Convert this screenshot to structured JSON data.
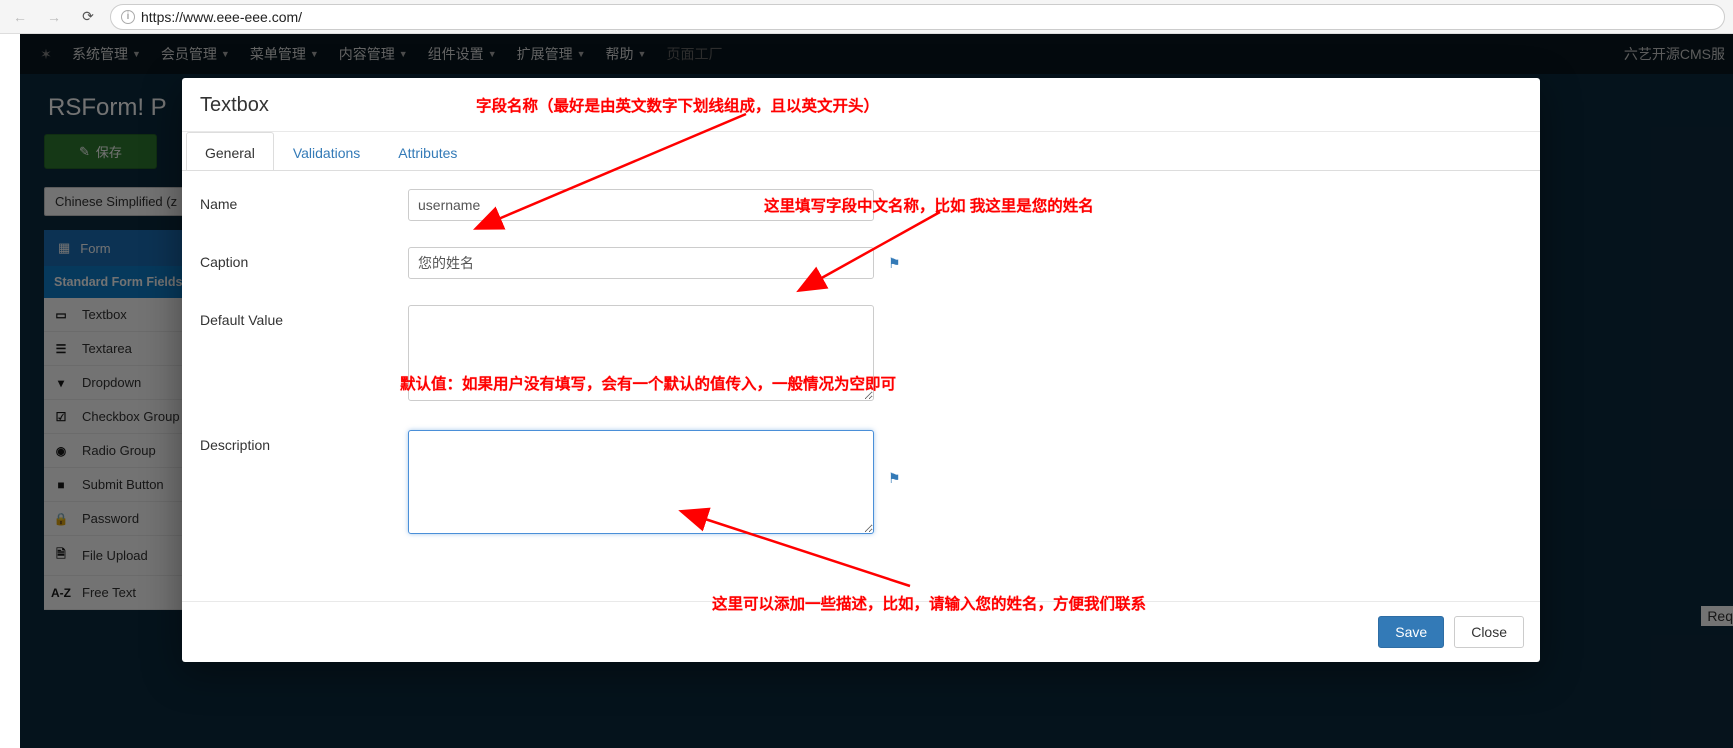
{
  "browser": {
    "url": "https://www.eee-eee.com/"
  },
  "topmenu": {
    "items": [
      "系统管理",
      "会员管理",
      "菜单管理",
      "内容管理",
      "组件设置",
      "扩展管理",
      "帮助"
    ],
    "muted": "页面工厂",
    "right": "六艺开源CMS服"
  },
  "page": {
    "title": "RSForm! P",
    "save_btn": "保存",
    "lang": "Chinese Simplified (z",
    "form_side_label": "Form",
    "section_title": "Standard Form Fields",
    "req_hint": "Req"
  },
  "side_items": [
    {
      "icon": "▭",
      "label": "Textbox"
    },
    {
      "icon": "☰",
      "label": "Textarea"
    },
    {
      "icon": "▾",
      "label": "Dropdown"
    },
    {
      "icon": "☑",
      "label": "Checkbox Group"
    },
    {
      "icon": "◉",
      "label": "Radio Group"
    },
    {
      "icon": "■",
      "label": "Submit Button"
    },
    {
      "icon": "🔒",
      "label": "Password"
    },
    {
      "icon": "🗎",
      "label": "File Upload"
    },
    {
      "icon": "A-Z",
      "label": "Free Text"
    }
  ],
  "modal": {
    "title": "Textbox",
    "tabs": {
      "general": "General",
      "validations": "Validations",
      "attributes": "Attributes"
    },
    "fields": {
      "name": {
        "label": "Name",
        "value": "username"
      },
      "caption": {
        "label": "Caption",
        "value": "您的姓名"
      },
      "default": {
        "label": "Default Value",
        "value": ""
      },
      "description": {
        "label": "Description",
        "value": ""
      }
    },
    "buttons": {
      "save": "Save",
      "close": "Close"
    }
  },
  "annotations": {
    "a1": "字段名称（最好是由英文数字下划线组成，且以英文开头）",
    "a2": "这里填写字段中文名称，比如 我这里是您的姓名",
    "a3": "默认值：如果用户没有填写，会有一个默认的值传入，一般情况为空即可",
    "a4": "这里可以添加一些描述，比如，请输入您的姓名，方便我们联系"
  }
}
